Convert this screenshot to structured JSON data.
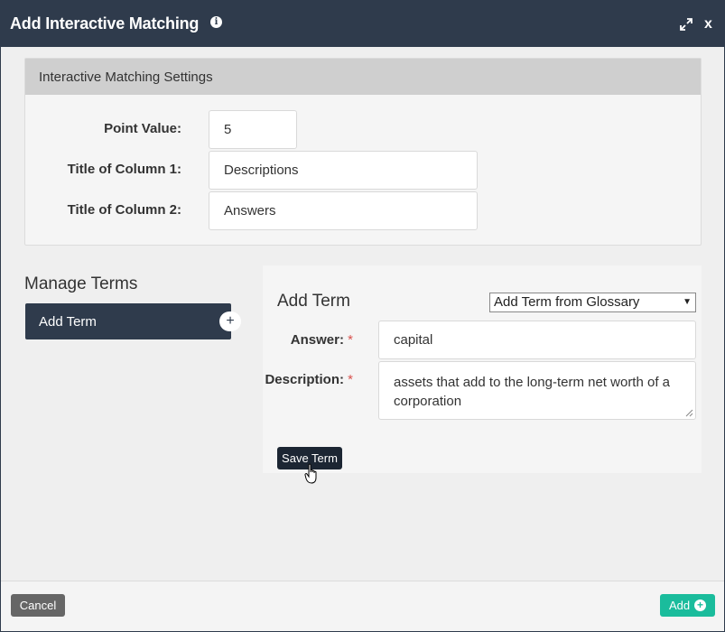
{
  "dialog": {
    "title": "Add Interactive Matching",
    "icons": {
      "info": "info-icon",
      "expand": "expand-icon",
      "close": "close-icon"
    },
    "close_label": "x"
  },
  "settings": {
    "header": "Interactive Matching Settings",
    "point_value_label": "Point Value:",
    "point_value": "5",
    "column1_label": "Title of Column 1:",
    "column1_value": "Descriptions",
    "column2_label": "Title of Column 2:",
    "column2_value": "Answers"
  },
  "manage_terms": {
    "title": "Manage Terms",
    "add_term_label": "Add Term",
    "plus_symbol": "+"
  },
  "add_term_form": {
    "title": "Add Term",
    "glossary_selected": "Add Term from Glossary",
    "answer_label": "Answer:",
    "answer_value": "capital",
    "description_label": "Description:",
    "description_value": "assets that add to the long-term net worth of a corporation",
    "required_mark": "*",
    "save_label": "Save Term"
  },
  "footer": {
    "cancel_label": "Cancel",
    "add_label": "Add"
  },
  "colors": {
    "header_bg": "#2f3b4c",
    "accent_green": "#1abc9c",
    "required_red": "#d9534f"
  }
}
